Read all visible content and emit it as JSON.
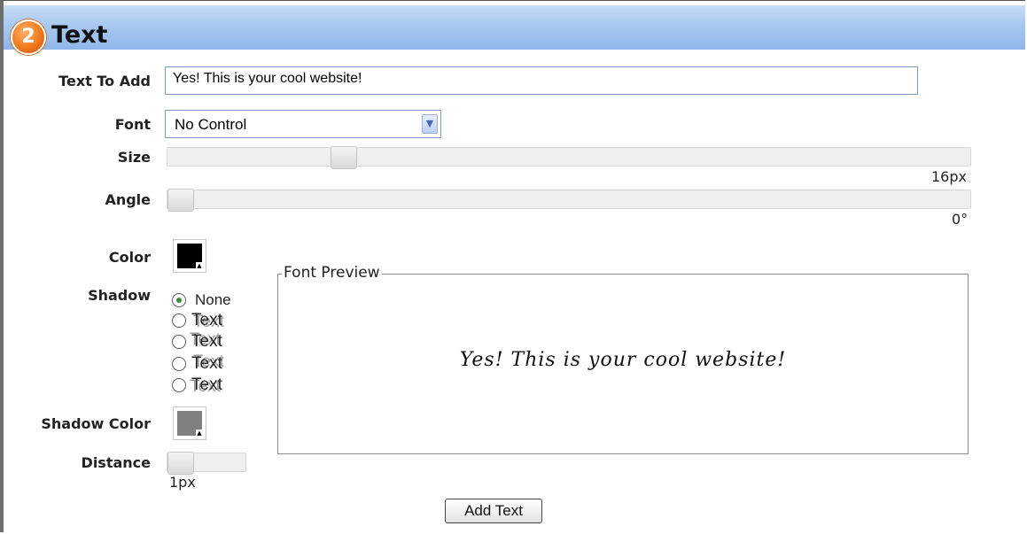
{
  "section": {
    "number": "2",
    "title": "Text"
  },
  "fields": {
    "text_to_add": {
      "label": "Text To Add",
      "value": "Yes!  This is your cool website!"
    },
    "font": {
      "label": "Font",
      "selected": "No Control"
    },
    "size": {
      "label": "Size",
      "value": "16px",
      "fraction": 0.21
    },
    "angle": {
      "label": "Angle",
      "value": "0°",
      "fraction": 0.0
    },
    "color": {
      "label": "Color",
      "hex": "#000000"
    },
    "shadow": {
      "label": "Shadow",
      "options": [
        "None",
        "Text",
        "Text",
        "Text",
        "Text"
      ],
      "selected_index": 0
    },
    "shadow_color": {
      "label": "Shadow Color",
      "hex": "#808080"
    },
    "distance": {
      "label": "Distance",
      "value": "1px",
      "fraction": 0.0
    }
  },
  "preview": {
    "legend": "Font Preview",
    "text": "Yes!  This is your cool website!"
  },
  "actions": {
    "add_text_label": "Add Text"
  }
}
